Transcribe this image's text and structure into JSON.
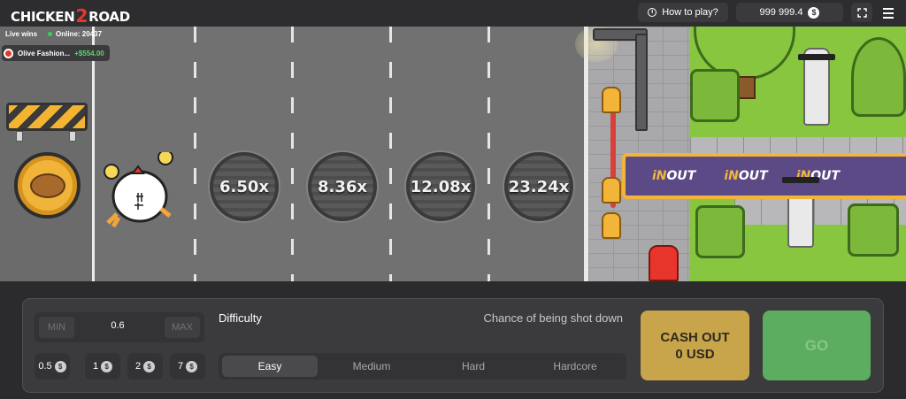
{
  "header": {
    "logo_left": "CHICKEN",
    "logo_num": "2",
    "logo_right": "ROAD",
    "how_to_play": "How to play?",
    "balance": "999 999.4",
    "currency_symbol": "$"
  },
  "live": {
    "live_wins_label": "Live wins",
    "online_label": "Online: 20437",
    "latest_win": {
      "player": "Olive Fashion...",
      "amount": "+$554.00"
    }
  },
  "road": {
    "multipliers": [
      "6.50x",
      "8.36x",
      "12.08x",
      "23.24x"
    ]
  },
  "banner": {
    "brand_prefix": "iN",
    "brand_suffix": "OUT"
  },
  "bet": {
    "min_label": "MIN",
    "max_label": "MAX",
    "value": "0.6",
    "quick_chips": [
      "0.5",
      "1",
      "2",
      "7"
    ]
  },
  "difficulty": {
    "label": "Difficulty",
    "chance_label": "Chance of being shot down",
    "options": [
      "Easy",
      "Medium",
      "Hard",
      "Hardcore"
    ],
    "selected": "Easy"
  },
  "actions": {
    "cashout_line1": "CASH OUT",
    "cashout_line2": "0 USD",
    "go": "GO"
  },
  "colors": {
    "accent_gold": "#c8a44b",
    "go_green": "#5cad5f",
    "win_green": "#62d36a",
    "banner_purple": "#5c4a86"
  }
}
